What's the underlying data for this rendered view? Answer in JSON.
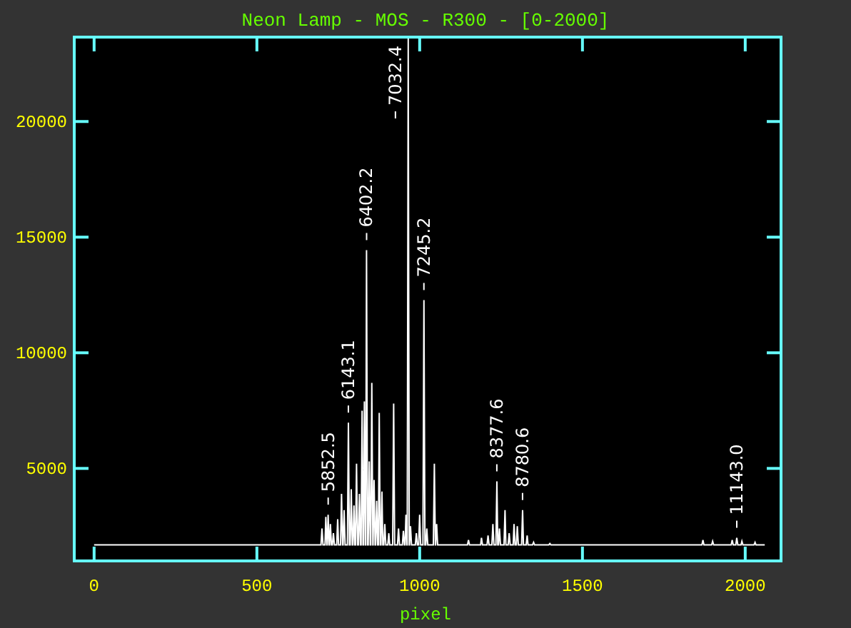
{
  "chart_data": {
    "type": "line",
    "title": "Neon Lamp - MOS - R300 - [0-2000]",
    "xlabel": "pixel",
    "xlim": [
      -61,
      2110
    ],
    "ylim": [
      1000,
      23650
    ],
    "xticks": [
      0,
      500,
      1000,
      1500,
      2000
    ],
    "yticks": [
      5000,
      10000,
      15000,
      20000
    ],
    "x": [
      0,
      697,
      700,
      703,
      709,
      712,
      715,
      716,
      719,
      722,
      723,
      726,
      729,
      732,
      735,
      738,
      745,
      748,
      751,
      757,
      760,
      763,
      765,
      768,
      771,
      778,
      781,
      784,
      787,
      790,
      793,
      795,
      798,
      801,
      803,
      806,
      809,
      812,
      815,
      818,
      820,
      823,
      826,
      827,
      830,
      833,
      834,
      837,
      840,
      842,
      845,
      848,
      850,
      853,
      856,
      857,
      860,
      863,
      865,
      868,
      871,
      873,
      876,
      879,
      881,
      884,
      887,
      890,
      893,
      896,
      902,
      905,
      908,
      917,
      920,
      923,
      932,
      935,
      938,
      947,
      950,
      953,
      955,
      958,
      961,
      962,
      965,
      968,
      969,
      972,
      975,
      987,
      990,
      993,
      997,
      1000,
      1003,
      1010,
      1013,
      1016,
      1019,
      1022,
      1025,
      1042,
      1045,
      1048,
      1049,
      1052,
      1055,
      1147,
      1150,
      1153,
      1187,
      1190,
      1193,
      1207,
      1210,
      1213,
      1222,
      1225,
      1228,
      1234,
      1237,
      1240,
      1242,
      1245,
      1248,
      1259,
      1262,
      1265,
      1272,
      1275,
      1278,
      1287,
      1290,
      1293,
      1297,
      1300,
      1303,
      1313,
      1316,
      1319,
      1327,
      1330,
      1333,
      1347,
      1350,
      1353,
      1397,
      1400,
      1403,
      1867,
      1870,
      1873,
      1897,
      1900,
      1903,
      1957,
      1960,
      1963,
      1971,
      1974,
      1977,
      1987,
      1990,
      1993,
      2027,
      2030,
      2033,
      2060
    ],
    "series": [
      {
        "color": "#ffffff",
        "values": [
          1700,
          1700,
          2400,
          1700,
          1700,
          2900,
          1700,
          1700,
          3000,
          1700,
          1700,
          2600,
          1700,
          1700,
          2200,
          1700,
          1700,
          2800,
          1700,
          1700,
          3900,
          1700,
          1700,
          3200,
          1700,
          1700,
          6980,
          1700,
          1700,
          4100,
          1700,
          1700,
          3400,
          1700,
          1700,
          5200,
          1700,
          1700,
          3900,
          1700,
          1700,
          7500,
          1700,
          1700,
          7900,
          1700,
          1700,
          14440,
          1700,
          1700,
          5300,
          1700,
          1700,
          8700,
          1700,
          1700,
          4500,
          1700,
          1700,
          3600,
          1700,
          1700,
          7400,
          1700,
          1700,
          4000,
          1700,
          1700,
          2600,
          1700,
          1700,
          2200,
          1700,
          1700,
          7800,
          1700,
          1700,
          2400,
          1700,
          1700,
          2300,
          1700,
          1700,
          3000,
          1700,
          1700,
          23600,
          1700,
          1700,
          2500,
          1700,
          1700,
          2200,
          1700,
          1700,
          3000,
          1700,
          1700,
          12280,
          1700,
          1700,
          2400,
          1700,
          1700,
          5200,
          1700,
          1700,
          2600,
          1700,
          1700,
          1900,
          1700,
          1700,
          2000,
          1700,
          1700,
          2100,
          1700,
          1700,
          2600,
          1700,
          1700,
          4440,
          1700,
          1700,
          2400,
          1700,
          1700,
          3200,
          1700,
          1700,
          2200,
          1700,
          1700,
          2600,
          1700,
          1700,
          2500,
          1700,
          1700,
          3200,
          1700,
          1700,
          2100,
          1700,
          1700,
          1800,
          1700,
          1700,
          1750,
          1700,
          1700,
          1900,
          1700,
          1700,
          1850,
          1700,
          1700,
          1900,
          1700,
          1700,
          2000,
          1700,
          1700,
          1850,
          1700,
          1700,
          1800,
          1700,
          1700
        ]
      }
    ],
    "annotations": [
      {
        "text": "5852.5",
        "x": 719,
        "y": 3000
      },
      {
        "text": "6143.1",
        "x": 781,
        "y": 6980
      },
      {
        "text": "6402.2",
        "x": 837,
        "y": 14440
      },
      {
        "text": "7032.4",
        "x": 965,
        "y": 23600
      },
      {
        "text": "7245.2",
        "x": 1013,
        "y": 12280
      },
      {
        "text": "8377.6",
        "x": 1237,
        "y": 4440
      },
      {
        "text": "8780.6",
        "x": 1316,
        "y": 3200
      },
      {
        "text": "11143.0",
        "x": 1974,
        "y": 2000
      }
    ]
  }
}
